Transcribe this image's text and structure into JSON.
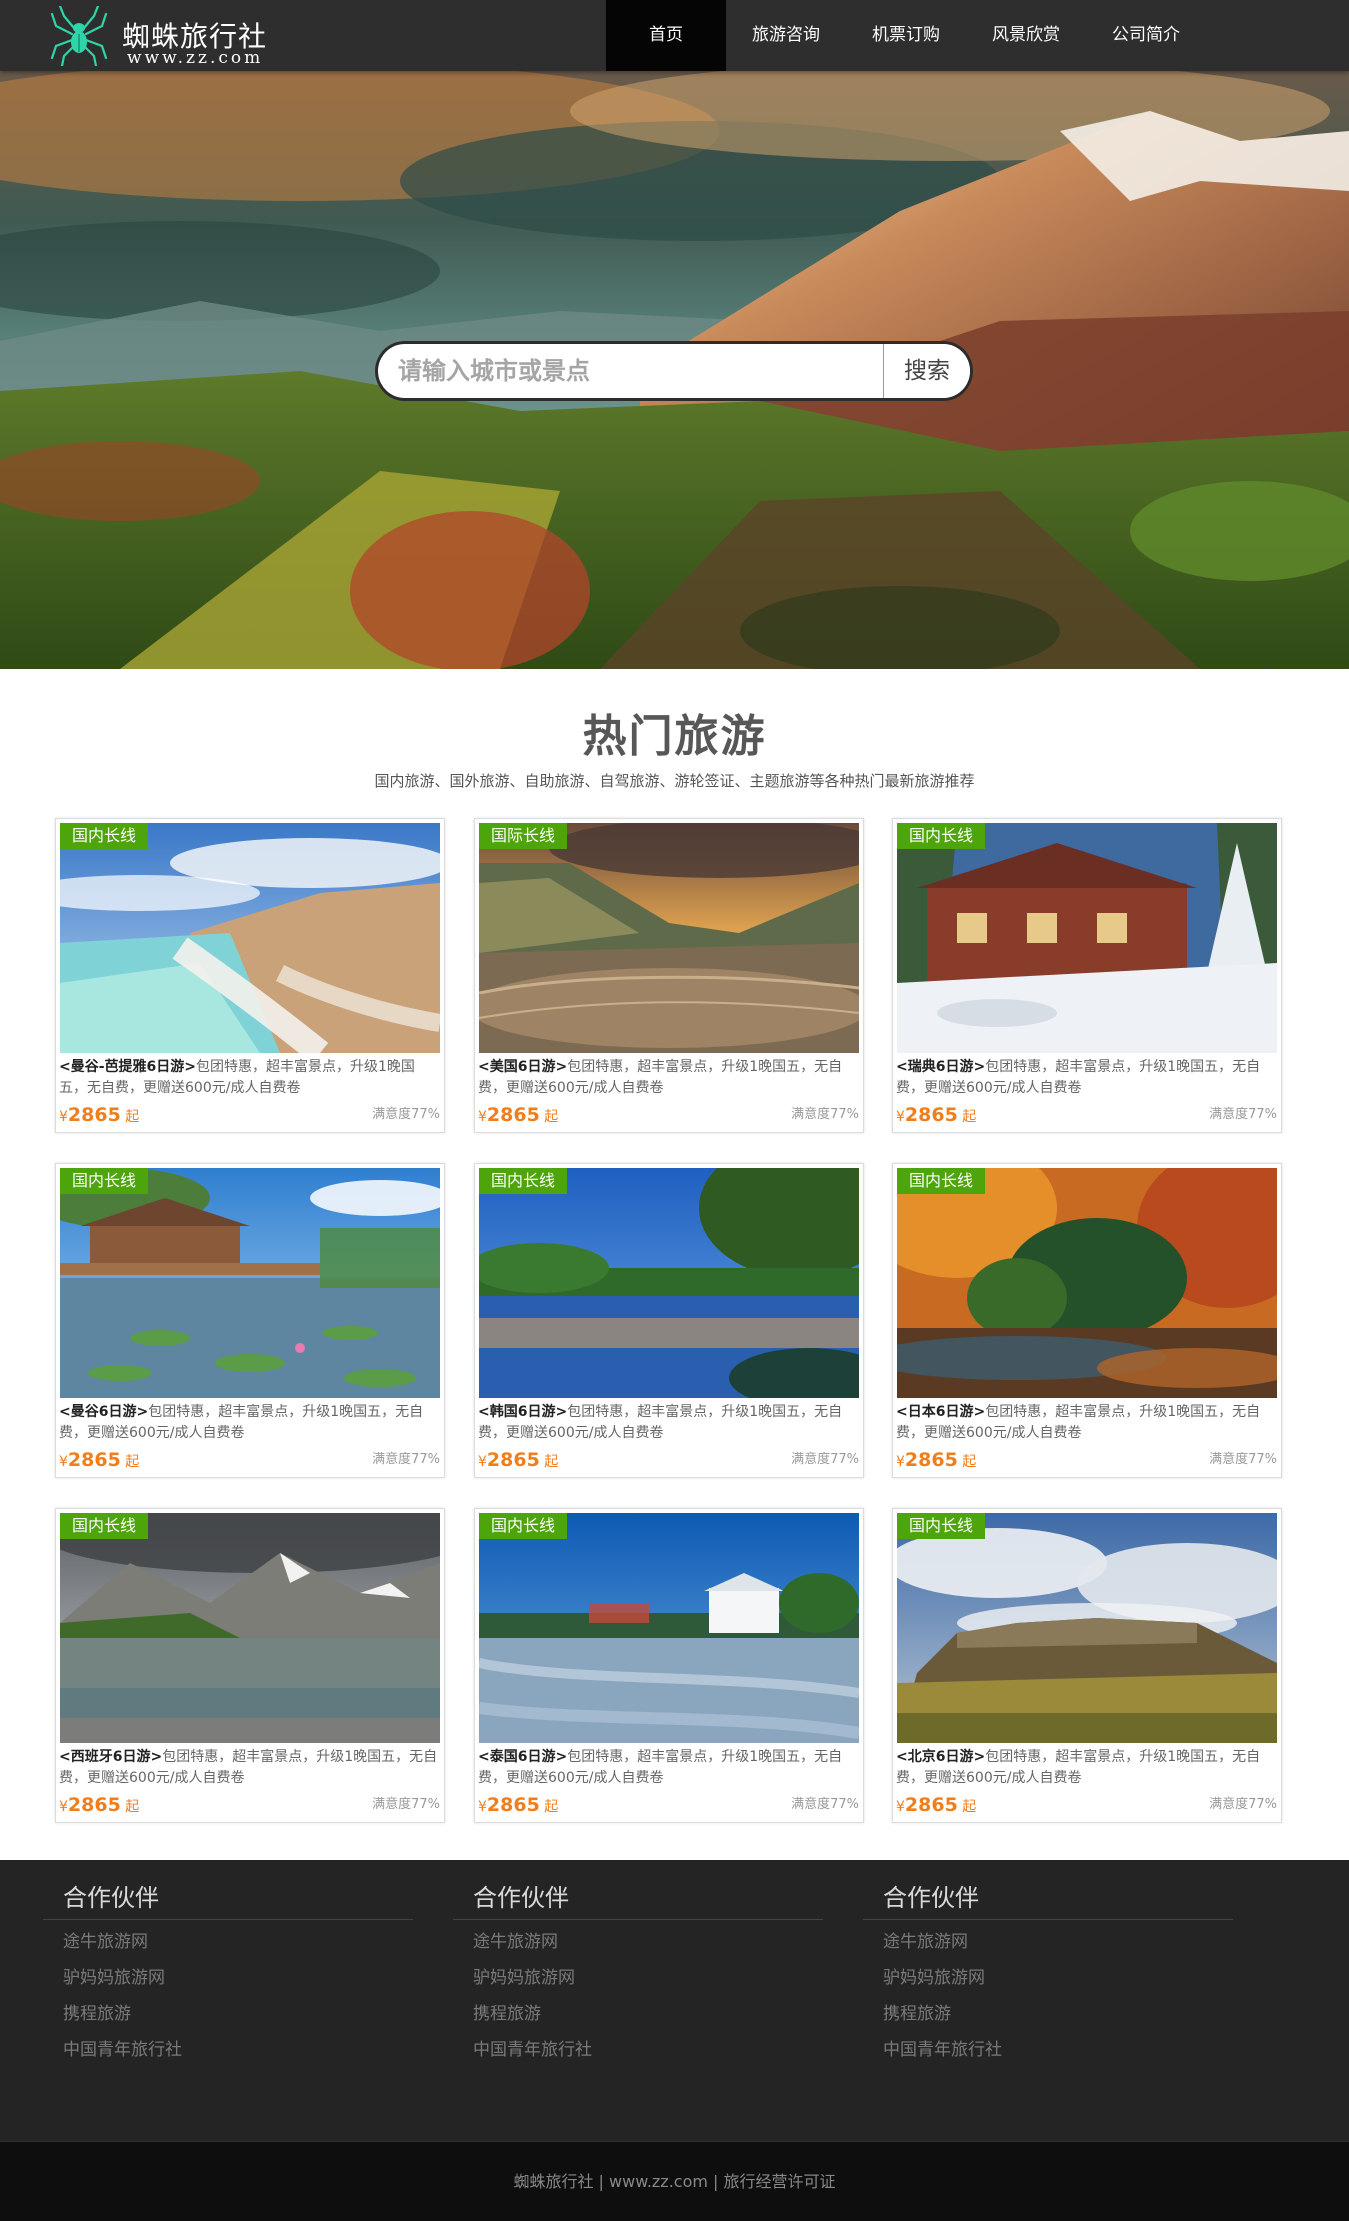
{
  "header": {
    "logo_title": "蜘蛛旅行社",
    "logo_url": "www.zz.com",
    "nav": [
      {
        "label": "首页",
        "active": true
      },
      {
        "label": "旅游咨询",
        "active": false
      },
      {
        "label": "机票订购",
        "active": false
      },
      {
        "label": "风景欣赏",
        "active": false
      },
      {
        "label": "公司简介",
        "active": false
      }
    ]
  },
  "search": {
    "placeholder": "请输入城市或景点",
    "button_label": "搜索"
  },
  "hot": {
    "title": "热门旅游",
    "subtitle": "国内旅游、国外旅游、自助旅游、自驾旅游、游轮签证、主题旅游等各种热门最新旅游推荐",
    "cards": [
      {
        "tag": "国内长线",
        "name": "<曼谷-芭提雅6日游>",
        "desc": "包团特惠，超丰富景点，升级1晚国五，无自费，更赠送600元/成人自费卷",
        "currency": "¥",
        "price": "2865",
        "price_suffix": "起",
        "satisfaction": "满意度77%"
      },
      {
        "tag": "国际长线",
        "name": "<美国6日游>",
        "desc": "包团特惠，超丰富景点，升级1晚国五，无自费，更赠送600元/成人自费卷",
        "currency": "¥",
        "price": "2865",
        "price_suffix": "起",
        "satisfaction": "满意度77%"
      },
      {
        "tag": "国内长线",
        "name": "<瑞典6日游>",
        "desc": "包团特惠，超丰富景点，升级1晚国五，无自费，更赠送600元/成人自费卷",
        "currency": "¥",
        "price": "2865",
        "price_suffix": "起",
        "satisfaction": "满意度77%"
      },
      {
        "tag": "国内长线",
        "name": "<曼谷6日游>",
        "desc": "包团特惠，超丰富景点，升级1晚国五，无自费，更赠送600元/成人自费卷",
        "currency": "¥",
        "price": "2865",
        "price_suffix": "起",
        "satisfaction": "满意度77%"
      },
      {
        "tag": "国内长线",
        "name": "<韩国6日游>",
        "desc": "包团特惠，超丰富景点，升级1晚国五，无自费，更赠送600元/成人自费卷",
        "currency": "¥",
        "price": "2865",
        "price_suffix": "起",
        "satisfaction": "满意度77%"
      },
      {
        "tag": "国内长线",
        "name": "<日本6日游>",
        "desc": "包团特惠，超丰富景点，升级1晚国五，无自费，更赠送600元/成人自费卷",
        "currency": "¥",
        "price": "2865",
        "price_suffix": "起",
        "satisfaction": "满意度77%"
      },
      {
        "tag": "国内长线",
        "name": "<西班牙6日游>",
        "desc": "包团特惠，超丰富景点，升级1晚国五，无自费，更赠送600元/成人自费卷",
        "currency": "¥",
        "price": "2865",
        "price_suffix": "起",
        "satisfaction": "满意度77%"
      },
      {
        "tag": "国内长线",
        "name": "<泰国6日游>",
        "desc": "包团特惠，超丰富景点，升级1晚国五，无自费，更赠送600元/成人自费卷",
        "currency": "¥",
        "price": "2865",
        "price_suffix": "起",
        "satisfaction": "满意度77%"
      },
      {
        "tag": "国内长线",
        "name": "<北京6日游>",
        "desc": "包团特惠，超丰富景点，升级1晚国五，无自费，更赠送600元/成人自费卷",
        "currency": "¥",
        "price": "2865",
        "price_suffix": "起",
        "satisfaction": "满意度77%"
      }
    ]
  },
  "footer": {
    "columns": [
      {
        "title": "合作伙伴",
        "links": [
          "途牛旅游网",
          "驴妈妈旅游网",
          "携程旅游",
          "中国青年旅行社"
        ]
      },
      {
        "title": "合作伙伴",
        "links": [
          "途牛旅游网",
          "驴妈妈旅游网",
          "携程旅游",
          "中国青年旅行社"
        ]
      },
      {
        "title": "合作伙伴",
        "links": [
          "途牛旅游网",
          "驴妈妈旅游网",
          "携程旅游",
          "中国青年旅行社"
        ]
      }
    ],
    "copyright": "蜘蛛旅行社 | www.zz.com | 旅行经营许可证"
  },
  "colors": {
    "header_bg": "#2e2e2e",
    "nav_active_bg": "#050505",
    "tag_green": "#4ea50b",
    "price_orange": "#f27e1b",
    "footer_bg": "#242424",
    "copyright_bg": "#0e0e0e",
    "logo_spider": "#2fd4a8"
  },
  "icons": {
    "logo": "spider-icon"
  }
}
